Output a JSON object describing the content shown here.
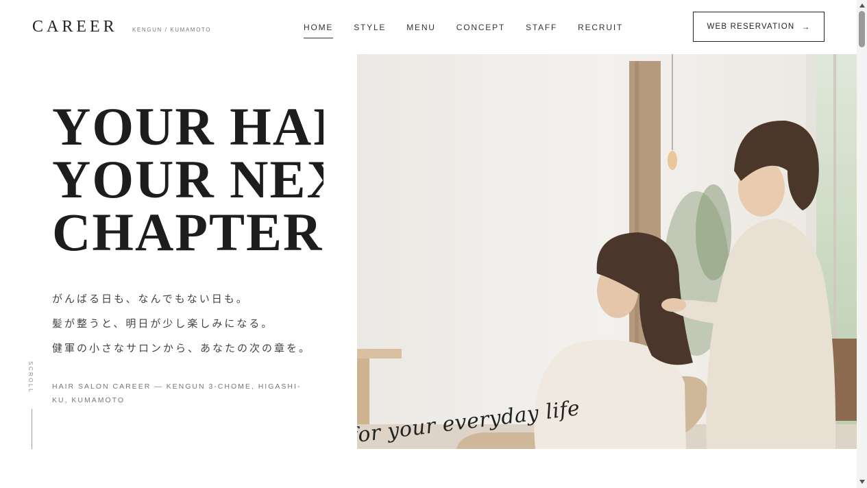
{
  "header": {
    "logo": "CAREER",
    "logo_sub": "KENGUN / KUMAMOTO",
    "nav": [
      {
        "label": "HOME",
        "active": true
      },
      {
        "label": "STYLE"
      },
      {
        "label": "MENU"
      },
      {
        "label": "CONCEPT"
      },
      {
        "label": "STAFF"
      },
      {
        "label": "RECRUIT"
      }
    ],
    "reservation": {
      "label": "WEB RESERVATION",
      "arrow": "→"
    }
  },
  "hero": {
    "title_lines": [
      "YOUR HAIR,",
      "YOUR NEXT",
      "CHAPTER."
    ],
    "copy_lines": [
      "がんばる日も、なんでもない日も。",
      "髪が整うと、明日が少し楽しみになる。",
      "健軍の小さなサロンから、あなたの次の章を。"
    ],
    "address": "HAIR SALON CAREER — KENGUN 3-CHOME, HIGASHI-KU, KUMAMOTO",
    "scroll_label": "SCROLL",
    "image_script": "for your everyday life"
  },
  "colors": {
    "text": "#1d1d1d",
    "muted": "#777777",
    "background": "#ffffff"
  }
}
